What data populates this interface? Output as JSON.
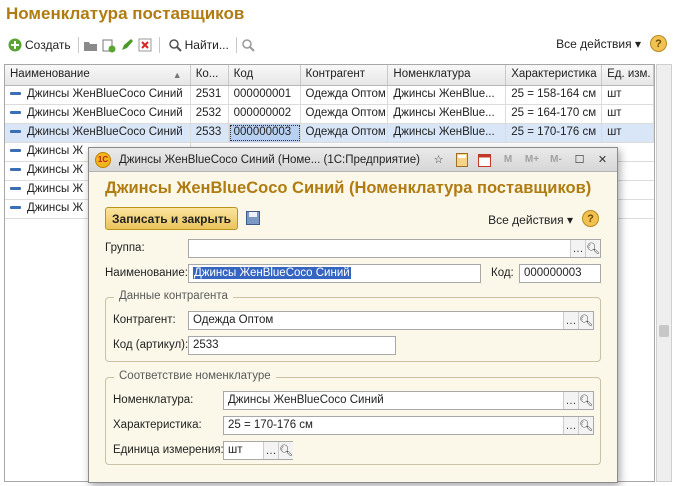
{
  "page": {
    "title": "Номенклатура поставщиков"
  },
  "toolbar": {
    "create_label": "Создать",
    "find_label": "Найти...",
    "all_actions_label": "Все действия ▾",
    "help": "?"
  },
  "table": {
    "headers": [
      "Наименование",
      "Ко...",
      "Код",
      "Контрагент",
      "Номенклатура",
      "Характеристика",
      "Ед. изм."
    ],
    "rows": [
      {
        "name": "Джинсы ЖенBlueCoco Синий",
        "article": "2531",
        "code": "000000001",
        "counterparty": "Одежда Оптом",
        "nomenclature": "Джинсы ЖенBlue...",
        "characteristic": "25 = 158-164 см",
        "unit": "шт"
      },
      {
        "name": "Джинсы ЖенBlueCoco Синий",
        "article": "2532",
        "code": "000000002",
        "counterparty": "Одежда Оптом",
        "nomenclature": "Джинсы ЖенBlue...",
        "characteristic": "25 = 164-170 см",
        "unit": "шт"
      },
      {
        "name": "Джинсы ЖенBlueCoco Синий",
        "article": "2533",
        "code": "000000003",
        "counterparty": "Одежда Оптом",
        "nomenclature": "Джинсы ЖенBlue...",
        "characteristic": "25 = 170-176 см",
        "unit": "шт"
      },
      {
        "name": "Джинсы Ж"
      },
      {
        "name": "Джинсы Ж"
      },
      {
        "name": "Джинсы Ж"
      },
      {
        "name": "Джинсы Ж"
      }
    ]
  },
  "modal": {
    "window_title": "Джинсы ЖенBlueCoco Синий (Номе...   (1С:Предприятие)",
    "heading": "Джинсы ЖенBlueCoco Синий (Номенклатура поставщиков)",
    "save_close_label": "Записать и закрыть",
    "all_actions_label": "Все действия ▾",
    "help": "?",
    "group_label": "Группа:",
    "group_value": "",
    "name_label": "Наименование:",
    "name_value": "Джинсы ЖенBlueCoco Синий",
    "code_label": "Код:",
    "code_value": "000000003",
    "counterparty_section": "Данные контрагента",
    "counterparty_label": "Контрагент:",
    "counterparty_value": "Одежда Оптом",
    "article_label": "Код (артикул):",
    "article_value": "2533",
    "nomenclature_section": "Соответствие номенклатуре",
    "nomenclature_label": "Номенклатура:",
    "nomenclature_value": "Джинсы ЖенBlueCoco Синий",
    "characteristic_label": "Характеристика:",
    "characteristic_value": "25 = 170-176 см",
    "unit_label": "Единица измерения:",
    "unit_value": "шт",
    "tbar_buttons": [
      "M",
      "M+",
      "M-"
    ]
  },
  "colors": {
    "accent": "#b07c12",
    "selected_row": "#d8e6f8",
    "save_button": "#f2d27a"
  }
}
